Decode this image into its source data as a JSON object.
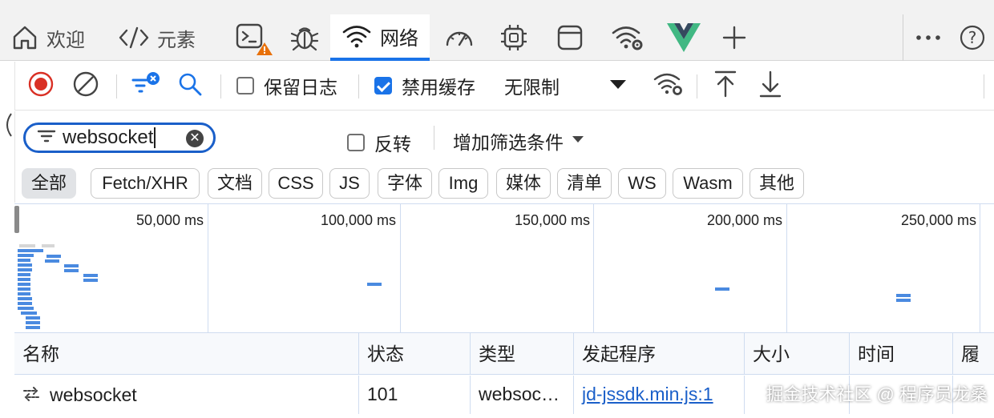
{
  "tabs": {
    "welcome": "欢迎",
    "elements": "元素",
    "network": "网络"
  },
  "toolbar": {
    "preserve_log": "保留日志",
    "disable_cache": "禁用缓存",
    "throttling": "无限制"
  },
  "filter": {
    "search_value": "websocket",
    "invert": "反转",
    "more_filters": "增加筛选条件"
  },
  "chips": [
    "全部",
    "Fetch/XHR",
    "文档",
    "CSS",
    "JS",
    "字体",
    "Img",
    "媒体",
    "清单",
    "WS",
    "Wasm",
    "其他"
  ],
  "overview": {
    "labels": [
      "50,000 ms",
      "100,000 ms",
      "150,000 ms",
      "200,000 ms",
      "250,000 ms"
    ]
  },
  "table": {
    "headers": [
      "名称",
      "状态",
      "类型",
      "发起程序",
      "大小",
      "时间",
      "履行"
    ],
    "rows": [
      {
        "name": "websocket",
        "status": "101",
        "type": "websoc…",
        "initiator": "jd-jssdk.min.js:1"
      }
    ]
  },
  "watermark": "掘金技术社区 @ 程序员龙桑",
  "colors": {
    "accent": "#1a73e8",
    "record": "#d93025",
    "vue": "#41b883",
    "warning": "#e8710a"
  }
}
